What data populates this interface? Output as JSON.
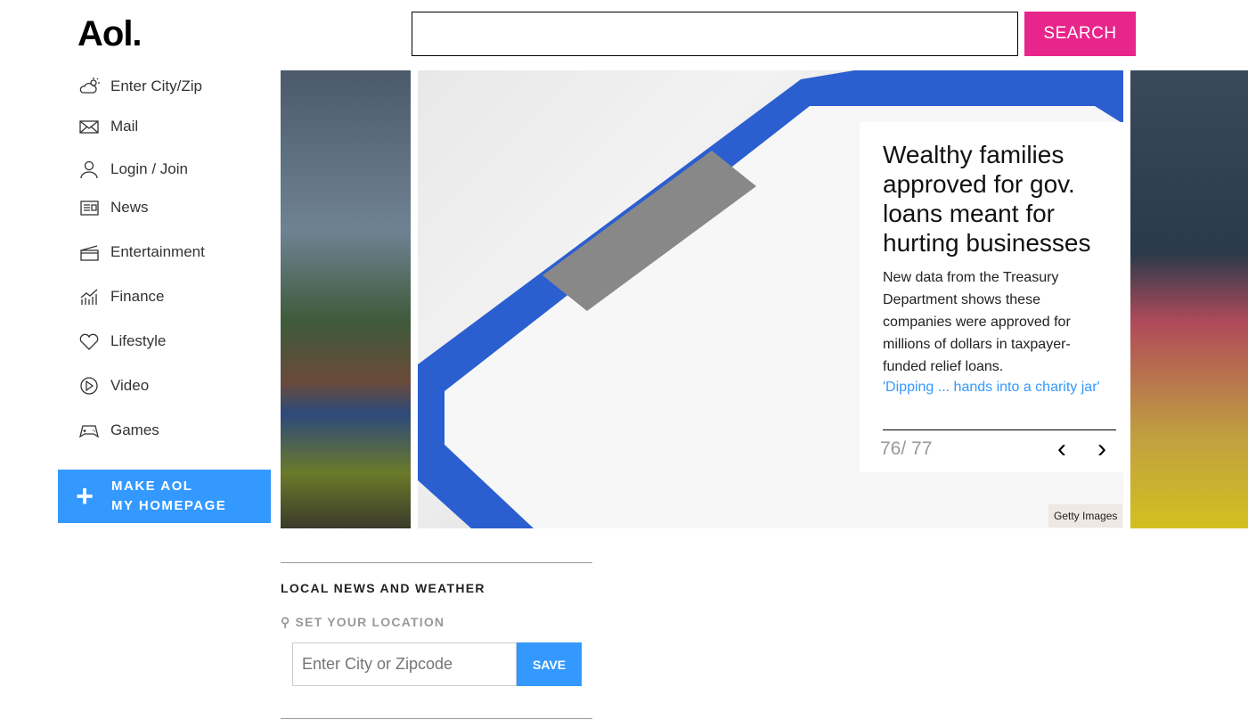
{
  "header": {
    "logo": "Aol.",
    "search_value": "",
    "search_label": "SEARCH"
  },
  "nav": [
    {
      "label": "Enter City/Zip",
      "icon": "weather-icon"
    },
    {
      "label": "Mail",
      "icon": "mail-icon"
    },
    {
      "label": "Login / Join",
      "icon": "user-icon"
    },
    {
      "label": "News",
      "icon": "news-icon"
    },
    {
      "label": "Entertainment",
      "icon": "clapperboard-icon"
    },
    {
      "label": "Finance",
      "icon": "finance-icon"
    },
    {
      "label": "Lifestyle",
      "icon": "heart-icon"
    },
    {
      "label": "Video",
      "icon": "play-icon"
    },
    {
      "label": "Games",
      "icon": "gamepad-icon"
    }
  ],
  "make_homepage": {
    "line1": "MAKE AOL",
    "line2": "MY HOMEPAGE"
  },
  "carousel": {
    "title": "Wealthy families approved for gov. loans meant for hurting businesses",
    "summary": "New data from the Treasury Department shows these companies were approved for millions of dollars in taxpayer-funded relief loans.",
    "link": "'Dipping ... hands into a charity jar'",
    "counter": "76/ 77",
    "credit": "Getty Images"
  },
  "local": {
    "title": "LOCAL NEWS AND WEATHER",
    "set_location": "SET YOUR LOCATION",
    "input_placeholder": "Enter City or Zipcode",
    "save_label": "SAVE"
  },
  "colors": {
    "search": "#e8258a",
    "accent": "#3399ff"
  }
}
